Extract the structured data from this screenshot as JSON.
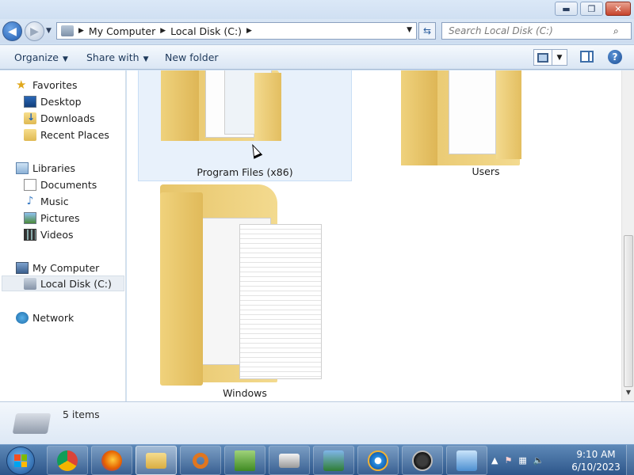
{
  "window": {
    "buttons": {
      "minimize": "▬",
      "maximize": "❐",
      "close": "✕"
    }
  },
  "address": {
    "crumbs": [
      "My Computer",
      "Local Disk (C:)"
    ],
    "search_placeholder": "Search Local Disk (C:)"
  },
  "toolbar": {
    "organize": "Organize",
    "share_with": "Share with",
    "new_folder": "New folder",
    "help": "?"
  },
  "nav": {
    "favorites": "Favorites",
    "desktop": "Desktop",
    "downloads": "Downloads",
    "recent_places": "Recent Places",
    "libraries": "Libraries",
    "documents": "Documents",
    "music": "Music",
    "pictures": "Pictures",
    "videos": "Videos",
    "my_computer": "My Computer",
    "local_disk": "Local Disk (C:)",
    "network": "Network"
  },
  "items": [
    {
      "name": "Program Files (x86)",
      "selected": true
    },
    {
      "name": "Users",
      "selected": false
    },
    {
      "name": "Windows",
      "selected": false
    }
  ],
  "details": {
    "count": "5 items"
  },
  "taskbar": {
    "apps": [
      "chrome-icon",
      "firefox-icon",
      "explorer-icon",
      "search-app-icon",
      "spreadsheet-icon",
      "printer-icon",
      "security-icon",
      "ie-icon",
      "lock-icon",
      "control-panel-icon"
    ],
    "active_app": "explorer-icon",
    "clock_time": "9:10 AM",
    "clock_date": "6/10/2023"
  },
  "colors": {
    "selection": "#e8f1fb",
    "taskbar": "#2d568a",
    "folder": "#f0d27c"
  }
}
